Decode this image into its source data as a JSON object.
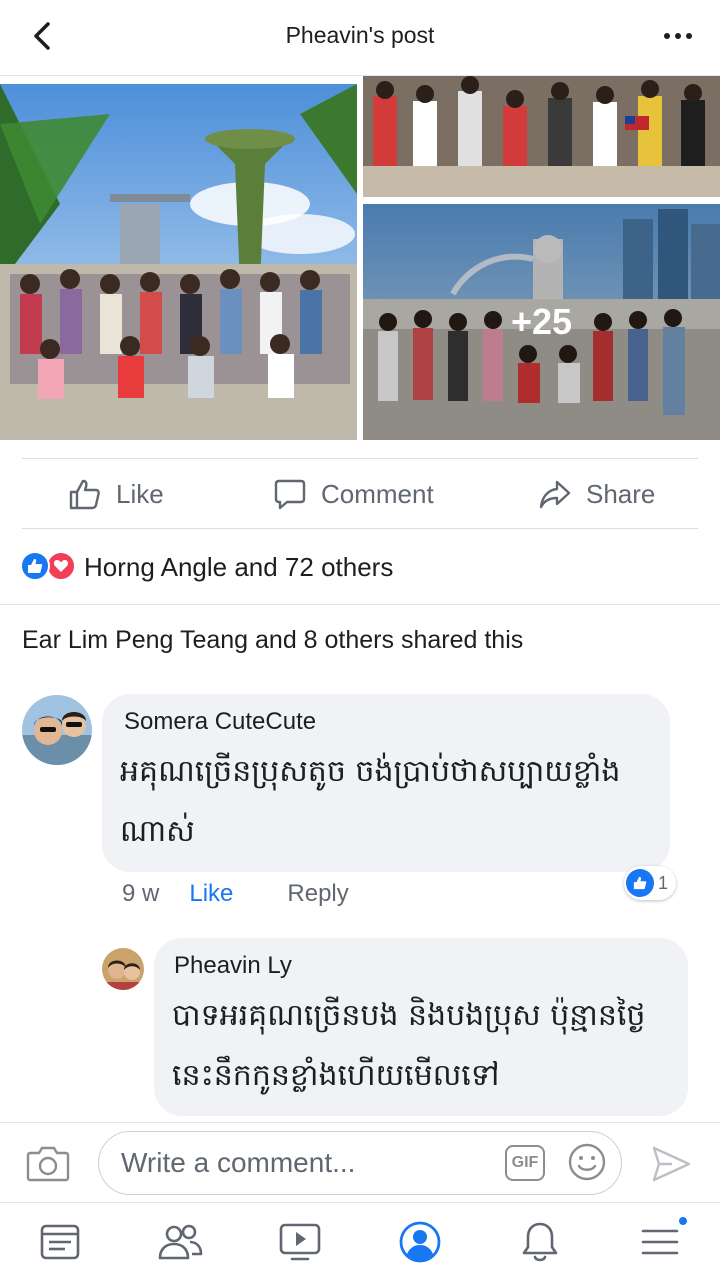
{
  "header": {
    "title": "Pheavin's post",
    "back_icon": "chevron-left-icon",
    "more_icon": "more-horizontal-icon"
  },
  "photos": {
    "more_count": "+25"
  },
  "actions": {
    "like_label": "Like",
    "comment_label": "Comment",
    "share_label": "Share"
  },
  "reactions": {
    "text": "Horng Angle and 72 others",
    "icons": [
      "like-reaction-icon",
      "love-reaction-icon"
    ]
  },
  "shares": {
    "text": "Ear Lim Peng Teang and 8 others shared this"
  },
  "comments": [
    {
      "author": "Somera CuteCute",
      "text": "អគុណច្រើនប្រុសតូច ចង់ប្រាប់ថាសប្បាយខ្លាំងណាស់",
      "time": "9 w",
      "like_label": "Like",
      "reply_label": "Reply",
      "reaction_count": "1"
    },
    {
      "author": "Pheavin Ly",
      "text": "បាទអរគុណច្រើនបង និងបងប្រុស ប៉ុន្មានថ្ងៃនេះនឹកកូនខ្លាំងហើយមើលទៅ"
    }
  ],
  "compose": {
    "placeholder": "Write a comment...",
    "gif_label": "GIF"
  },
  "nav": {
    "items": [
      "news-feed-icon",
      "friends-icon",
      "watch-icon",
      "profile-icon",
      "notifications-icon",
      "menu-icon"
    ],
    "active": "profile-icon"
  },
  "colors": {
    "accent": "#1877f2",
    "love": "#f33e58",
    "bubble": "#f0f2f5",
    "muted_text": "#606770"
  }
}
